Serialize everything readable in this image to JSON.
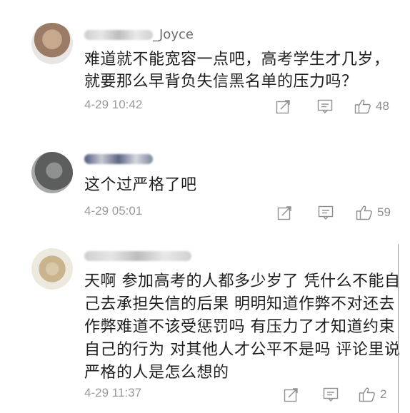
{
  "comments": [
    {
      "username_visible": "_Joyce",
      "text_lines": [
        "难道就不能宽容一点吧，高考学生才几岁，",
        "就要那么早背负失信黑名单的压力吗？"
      ],
      "time": "4-29 10:42",
      "likes": "48",
      "icons": [
        "share-icon",
        "reply-icon",
        "like-icon"
      ]
    },
    {
      "username_visible": "",
      "text_lines": [
        "这个过严格了吧"
      ],
      "time": "4-29 05:01",
      "likes": "59",
      "icons": [
        "share-icon",
        "reply-icon",
        "like-icon"
      ]
    },
    {
      "username_visible": "",
      "text_lines": [
        "天啊 参加高考的人都多少岁了 凭什么不能自",
        "己去承担失信的后果 明明知道作弊不对还去",
        "作弊难道不该受惩罚吗 有压力了才知道约束",
        "自己的行为 对其他人才公平不是吗 评论里说",
        "严格的人是怎么想的"
      ],
      "time": "4-29 11:37",
      "likes": "2",
      "icons": [
        "share-icon",
        "reply-icon",
        "like-icon"
      ]
    }
  ]
}
